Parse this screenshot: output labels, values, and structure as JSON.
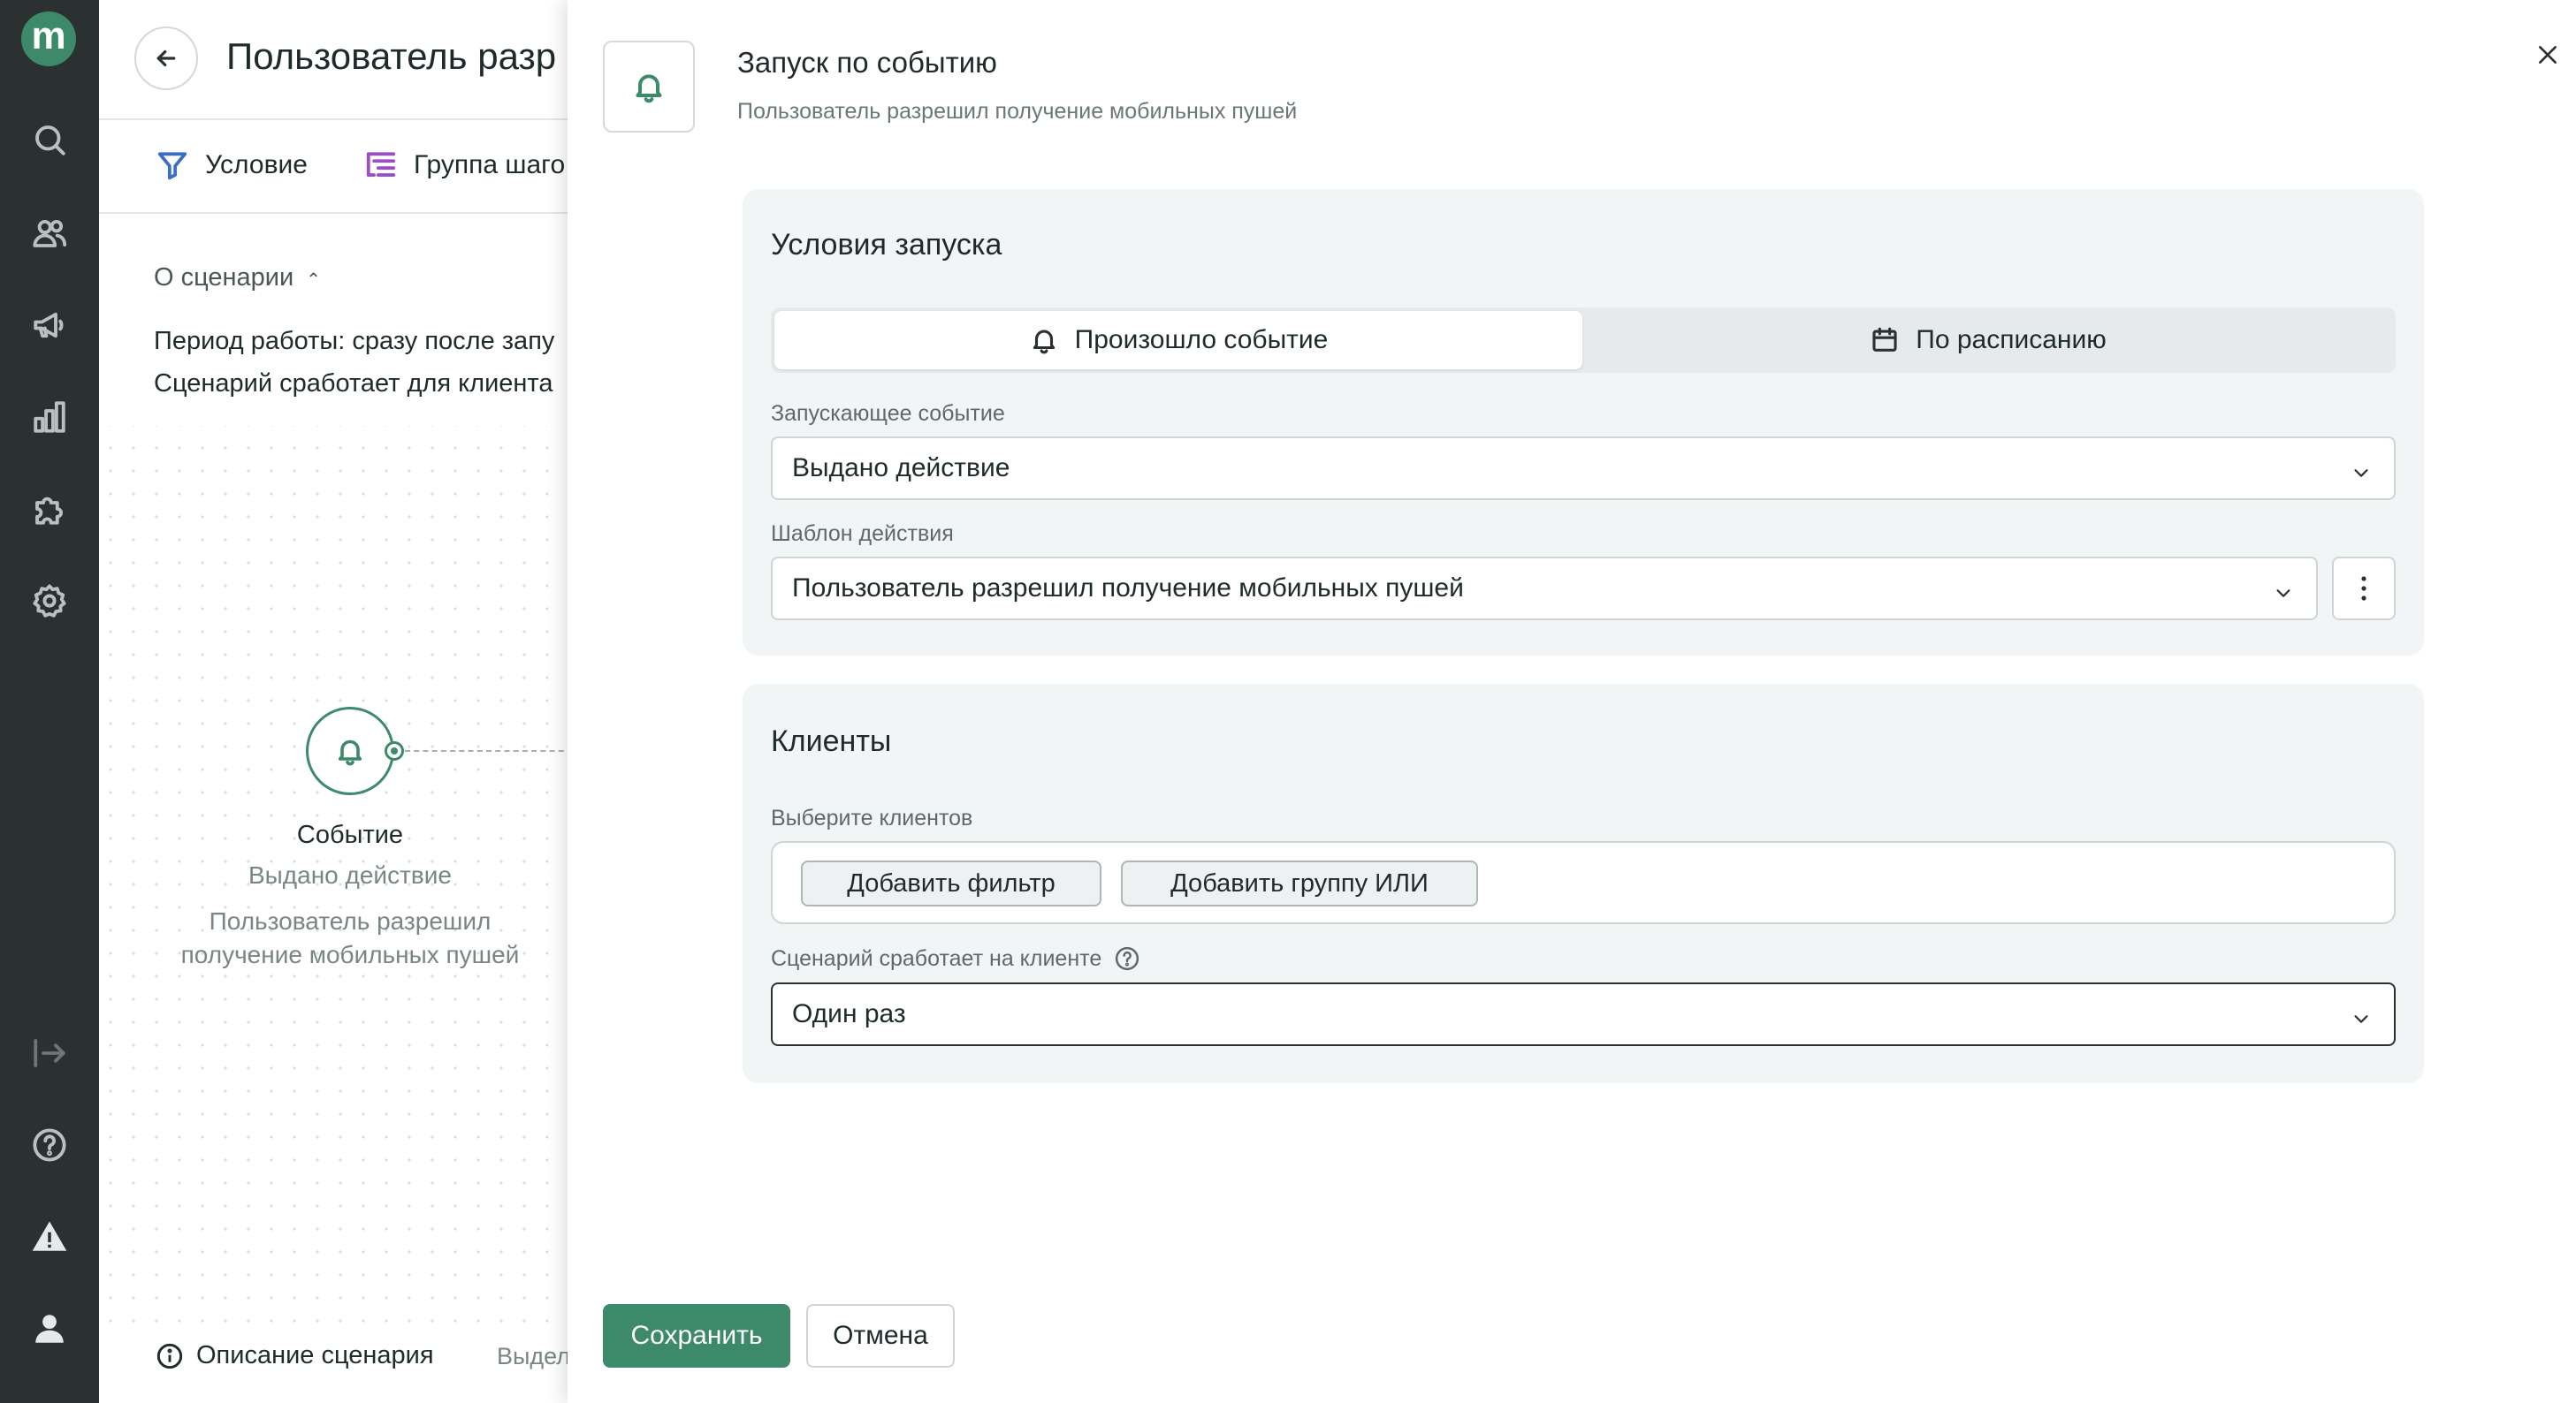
{
  "rail": {
    "logo_letter": "m",
    "icons": [
      "search-icon",
      "users-icon",
      "megaphone-icon",
      "bar-chart-icon",
      "puzzle-icon",
      "gear-icon",
      "logout-icon",
      "help-icon",
      "warning-icon",
      "user-icon"
    ]
  },
  "scenario": {
    "title": "Пользователь разр",
    "tabs": [
      {
        "label": "Условие",
        "icon": "filter-icon"
      },
      {
        "label": "Группа шаго",
        "icon": "step-group-icon"
      }
    ],
    "about": {
      "heading": "О сценарии",
      "period": "Период работы: сразу после запу",
      "works_for": "Сценарий сработает для клиента"
    },
    "node": {
      "type": "Событие",
      "event": "Выдано действие",
      "template": "Пользователь разрешил получение мобильных пушей"
    },
    "bottom": {
      "description_label": "Описание сценария",
      "selected_label": "Выдел"
    }
  },
  "drawer": {
    "title": "Запуск по событию",
    "subtitle": "Пользователь разрешил получение мобильных пушей",
    "launch": {
      "title": "Условия запуска",
      "mode_options": [
        {
          "label": "Произошло событие",
          "icon": "bell-icon",
          "active": true
        },
        {
          "label": "По расписанию",
          "icon": "calendar-icon",
          "active": false
        }
      ],
      "event_label": "Запускающее событие",
      "event_value": "Выдано действие",
      "template_label": "Шаблон действия",
      "template_value": "Пользователь разрешил получение мобильных пушей"
    },
    "clients": {
      "title": "Клиенты",
      "select_label": "Выберите клиентов",
      "add_filter": "Добавить фильтр",
      "add_or_group": "Добавить группу ИЛИ",
      "frequency_label": "Сценарий сработает на клиенте",
      "frequency_value": "Один раз"
    },
    "actions": {
      "save": "Сохранить",
      "cancel": "Отмена"
    }
  },
  "colors": {
    "accent": "#3d8a6a",
    "rail_bg": "#2b3131",
    "card_bg": "#f2f5f5"
  }
}
